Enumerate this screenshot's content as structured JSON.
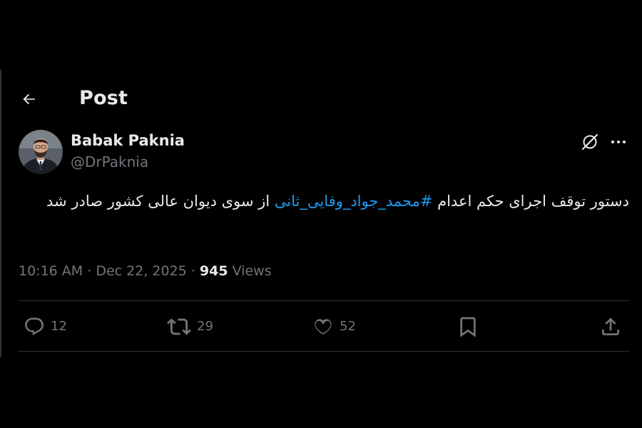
{
  "header": {
    "title": "Post",
    "back_icon": "arrow-left-icon"
  },
  "author": {
    "display_name": "Babak Paknia",
    "handle": "@DrPaknia",
    "avatar_icon": "avatar"
  },
  "post": {
    "text_before_hashtag": "دستور توقف اجرای حکم اعدام ",
    "hashtag": "#محمد_جواد_وفایی_ثانی",
    "text_after_hashtag": " از سوی دیوان عالی کشور صادر شد",
    "time": "10:16 AM",
    "date": "Dec 22, 2025",
    "views_count": "945",
    "views_label": "Views",
    "separator": "·"
  },
  "actions": {
    "replies": "12",
    "reposts": "29",
    "likes": "52"
  },
  "colors": {
    "background": "#000000",
    "primary_text": "#e7e9ea",
    "secondary_text": "#71767b",
    "link": "#1d9bf0",
    "divider": "#2f3336"
  }
}
